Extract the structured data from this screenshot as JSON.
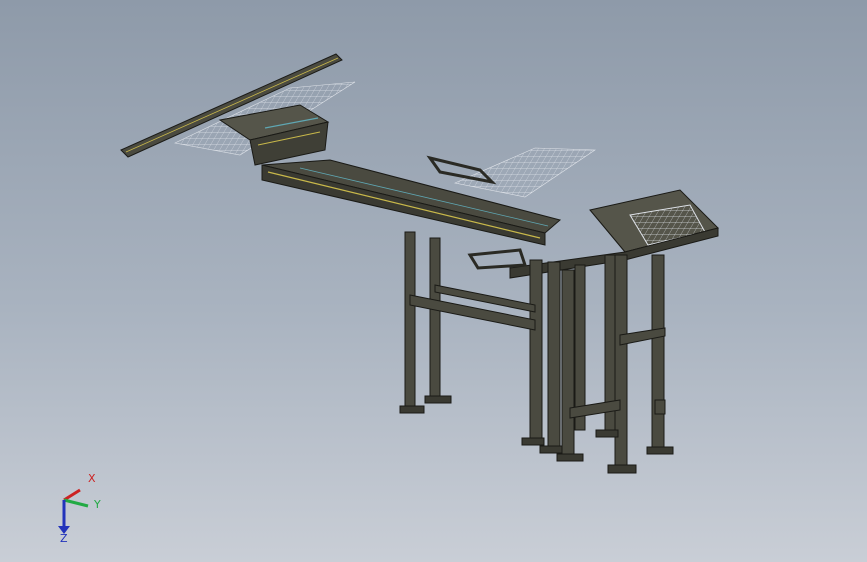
{
  "view": {
    "background_top": "#8e9aa9",
    "background_bottom": "#c9ced6",
    "steel_color": "#4a4a40",
    "steel_edge": "#1a1a16",
    "accent_yellow": "#c8b84a",
    "accent_cyan": "#5fa7b3",
    "mesh_color": "#d8dce2"
  },
  "triad": {
    "x_label": "X",
    "y_label": "Y",
    "z_label": "Z",
    "x_color": "#cc2222",
    "y_color": "#22aa44",
    "z_color": "#2233bb"
  }
}
